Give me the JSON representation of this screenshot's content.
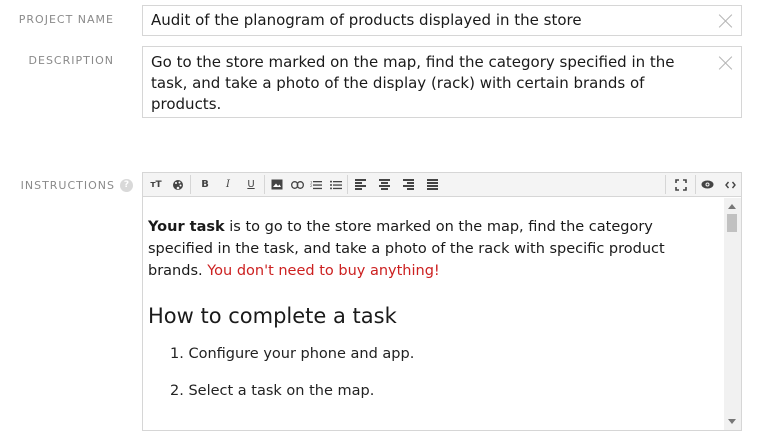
{
  "project_name": {
    "label": "PROJECT NAME",
    "value": "Audit of the planogram of products displayed in the store"
  },
  "description": {
    "label": "DESCRIPTION",
    "value": "Go to the store marked on the map, find the category specified in the task, and take a photo of the display (rack) with certain brands of products."
  },
  "instructions": {
    "label": "INSTRUCTIONS",
    "help": "?",
    "toolbar": {
      "text_size": "ᴛT",
      "bold": "B",
      "italic": "I",
      "underline": "U"
    },
    "content": {
      "intro_bold": "Your task",
      "intro_rest": " is to go to the store marked on the map, find the category specified in the task, and take a photo of the rack with specific product brands. ",
      "intro_red": "You don't need to buy anything!",
      "heading": "How to complete a task",
      "steps": [
        "1. Configure your phone and app.",
        "2. Select a task on the map."
      ]
    }
  },
  "colors": {
    "warning": "#cc2020",
    "border": "#d6d6d6",
    "label": "#8a8a8a"
  }
}
